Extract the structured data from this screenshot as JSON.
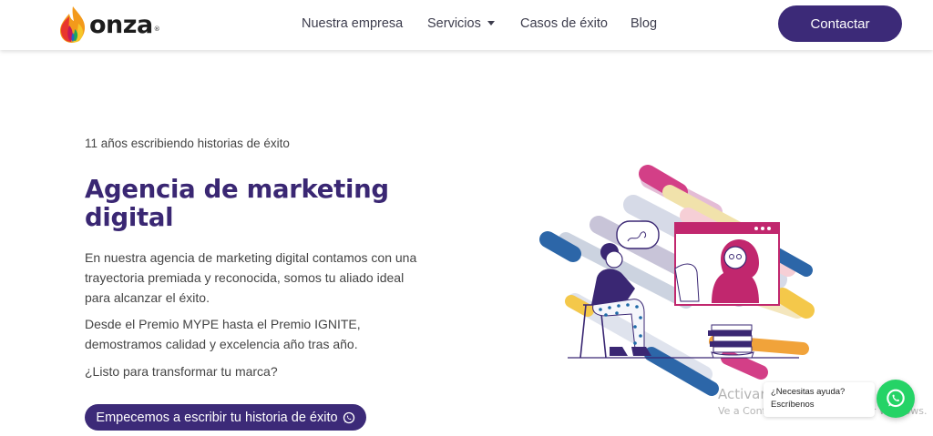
{
  "header": {
    "logo_text": "onza",
    "logo_reg": "®",
    "nav": {
      "empresa": "Nuestra empresa",
      "servicios": "Servicios",
      "casos": "Casos de éxito",
      "blog": "Blog"
    },
    "contact_label": "Contactar"
  },
  "hero": {
    "kicker": "11 años escribiendo historias de éxito",
    "title": "Agencia de marketing digital",
    "paragraph_1": "En nuestra agencia de marketing digital contamos con una trayectoria premiada y reconocida, somos tu aliado ideal para alcanzar el éxito.",
    "paragraph_2": "Desde el Premio MYPE hasta el Premio IGNITE, demostramos calidad y excelencia año tras año.",
    "paragraph_3": "¿Listo para transformar tu marca?",
    "cta_label": "Empecemos a escribir tu historia de éxito"
  },
  "whatsapp": {
    "question": "¿Necesitas ayuda?",
    "action": "Escríbenos"
  },
  "os_watermark": {
    "line_1": "Activar Windows",
    "line_2": "Ve a Configuración para activar Windows."
  },
  "colors": {
    "brand_purple": "#3c2a78",
    "headline_purple": "#3a2773",
    "whatsapp_green": "#25d366"
  },
  "icons": {
    "logo": "onza-flame-logo",
    "dropdown": "caret-down-icon",
    "cta": "whatsapp-icon",
    "float": "whatsapp-icon"
  }
}
